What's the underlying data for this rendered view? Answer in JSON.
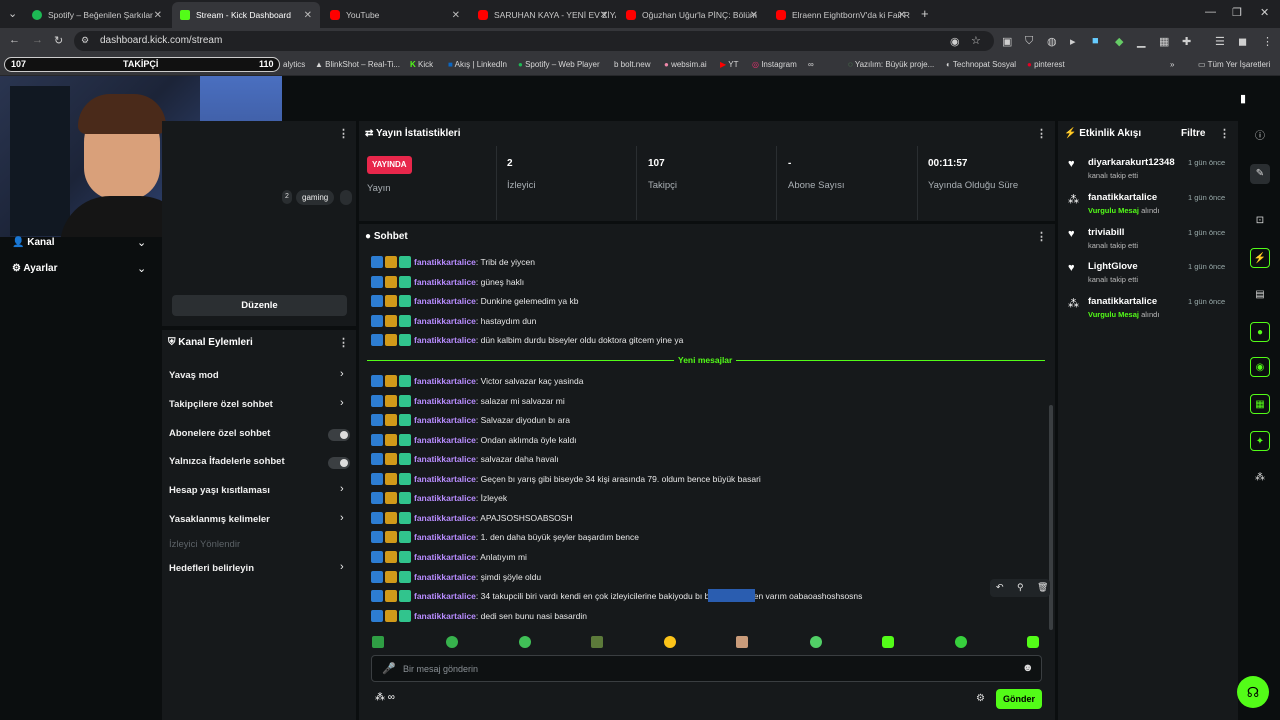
{
  "browser": {
    "tabs": [
      {
        "title": "Spotify – Beğenilen Şarkılar",
        "color": "#1db954",
        "active": false
      },
      {
        "title": "Stream - Kick Dashboard",
        "color": "#53fc18",
        "active": true
      },
      {
        "title": "YouTube",
        "color": "#ff0000",
        "active": false
      },
      {
        "title": "SARUHAN KAYA - YENİ EV ZİYA",
        "color": "#ff0000",
        "active": false
      },
      {
        "title": "Oğuzhan Uğur'la PİNÇ: Bölüm",
        "color": "#ff0000",
        "active": false
      },
      {
        "title": "Elraenn EightbornV'da ki Fail R",
        "color": "#ff0000",
        "active": false
      }
    ],
    "url": "dashboard.kick.com/stream",
    "bookmarks": [
      "alytics",
      "BlinkShot – Real-Ti...",
      "Kick",
      "Akış | LinkedIn",
      "Spotify – Web Player",
      "bolt.new",
      "websim.ai",
      "YT",
      "Instagram",
      "",
      "Yazılım: Büyük proje...",
      "Technopat Sosyal",
      "pinterest"
    ],
    "all_bookmarks": "Tüm Yer İşaretleri"
  },
  "overlay": {
    "left_count": "107",
    "label": "TAKİPÇİ",
    "right_count": "110"
  },
  "left": {
    "tag": "gaming",
    "tag_prefix": "2",
    "menu": [
      {
        "label": "Kanal"
      },
      {
        "label": "Ayarlar"
      }
    ],
    "edit_button": "Düzenle",
    "actions_title": "Kanal Eylemleri",
    "actions": [
      {
        "label": "Yavaş mod",
        "control": "chevron"
      },
      {
        "label": "Takipçilere özel sohbet",
        "control": "chevron"
      },
      {
        "label": "Abonelere özel sohbet",
        "control": "toggle"
      },
      {
        "label": "Yalnızca İfadelerle sohbet",
        "control": "toggle"
      },
      {
        "label": "Hesap yaşı kısıtlaması",
        "control": "chevron"
      },
      {
        "label": "Yasaklanmış kelimeler",
        "control": "chevron"
      },
      {
        "label": "İzleyici Yönlendir",
        "control": "none"
      },
      {
        "label": "Hedefleri belirleyin",
        "control": "chevron"
      }
    ]
  },
  "stats": {
    "title": "Yayın İstatistikleri",
    "live_badge": "YAYINDA",
    "items": [
      {
        "value": "",
        "label": "Yayın"
      },
      {
        "value": "2",
        "label": "İzleyici"
      },
      {
        "value": "107",
        "label": "Takipçi"
      },
      {
        "value": "-",
        "label": "Abone Sayısı"
      },
      {
        "value": "00:11:57",
        "label": "Yayında Olduğu Süre"
      }
    ]
  },
  "chat": {
    "title": "Sohbet",
    "new_messages": "Yeni mesajlar",
    "old": [
      {
        "user": "fanatikkartalice",
        "text": ": Tribi de yiycen"
      },
      {
        "user": "fanatikkartalice",
        "text": ": güneş haklı"
      },
      {
        "user": "fanatikkartalice",
        "text": ": Dunkine gelemedim ya kb"
      },
      {
        "user": "fanatikkartalice",
        "text": ": hastaydım dun"
      },
      {
        "user": "fanatikkartalice",
        "text": ": dün kalbim durdu biseyler oldu doktora gitcem yine ya"
      }
    ],
    "new": [
      {
        "user": "fanatikkartalice",
        "text": ": Victor salvazar kaç yasinda"
      },
      {
        "user": "fanatikkartalice",
        "text": ": salazar mi salvazar mi"
      },
      {
        "user": "fanatikkartalice",
        "text": ": Salvazar diyodun bı ara"
      },
      {
        "user": "fanatikkartalice",
        "text": ": Ondan aklımda öyle kaldı"
      },
      {
        "user": "fanatikkartalice",
        "text": ": salvazar daha havalı"
      },
      {
        "user": "fanatikkartalice",
        "text": ": Geçen bı yarış gibi biseyde 34 kişi arasında 79. oldum bence büyük basari"
      },
      {
        "user": "fanatikkartalice",
        "text": ": İzleyek"
      },
      {
        "user": "fanatikkartalice",
        "text": ": APAJSOSHSOABSOSH"
      },
      {
        "user": "fanatikkartalice",
        "text": ": 1. den daha büyük şeyler başardım bence"
      },
      {
        "user": "fanatikkartalice",
        "text": ": Anlatıyım mi"
      },
      {
        "user": "fanatikkartalice",
        "text": ": şimdi şöyle oldu"
      },
      {
        "user": "fanatikkartalice",
        "text": ": 34 takupcili biri vardı kendi en çok izleyicilerine bakiyodu bı baktı 79 da ben varım oabaoashoshsosns"
      },
      {
        "user": "fanatikkartalice",
        "text": ": dedi sen bunu nasi basardin"
      }
    ],
    "placeholder": "Bir mesaj gönderin",
    "send": "Gönder",
    "infinity": "∞"
  },
  "activity": {
    "title": "Etkinlik Akışı",
    "filter": "Filtre",
    "items": [
      {
        "name": "diyarkarakurt12348",
        "action_pre": "",
        "action_highlight": "",
        "action": "kanalı takip etti",
        "time": "1 gün önce",
        "icon": "heart"
      },
      {
        "name": "fanatikkartalice",
        "action_pre": "",
        "action_highlight": "Vurgulu Mesaj",
        "action": " alındı",
        "time": "1 gün önce",
        "icon": "kicks"
      },
      {
        "name": "triviabill",
        "action_pre": "",
        "action_highlight": "",
        "action": "kanalı takip etti",
        "time": "1 gün önce",
        "icon": "heart"
      },
      {
        "name": "LightGlove",
        "action_pre": "",
        "action_highlight": "",
        "action": "kanalı takip etti",
        "time": "1 gün önce",
        "icon": "heart"
      },
      {
        "name": "fanatikkartalice",
        "action_pre": "",
        "action_highlight": "Vurgulu Mesaj",
        "action": " alındı",
        "time": "1 gün önce",
        "icon": "kicks"
      }
    ]
  },
  "colors": {
    "accent": "#53fc18",
    "live": "#e8274b",
    "username": "#b88cff"
  }
}
